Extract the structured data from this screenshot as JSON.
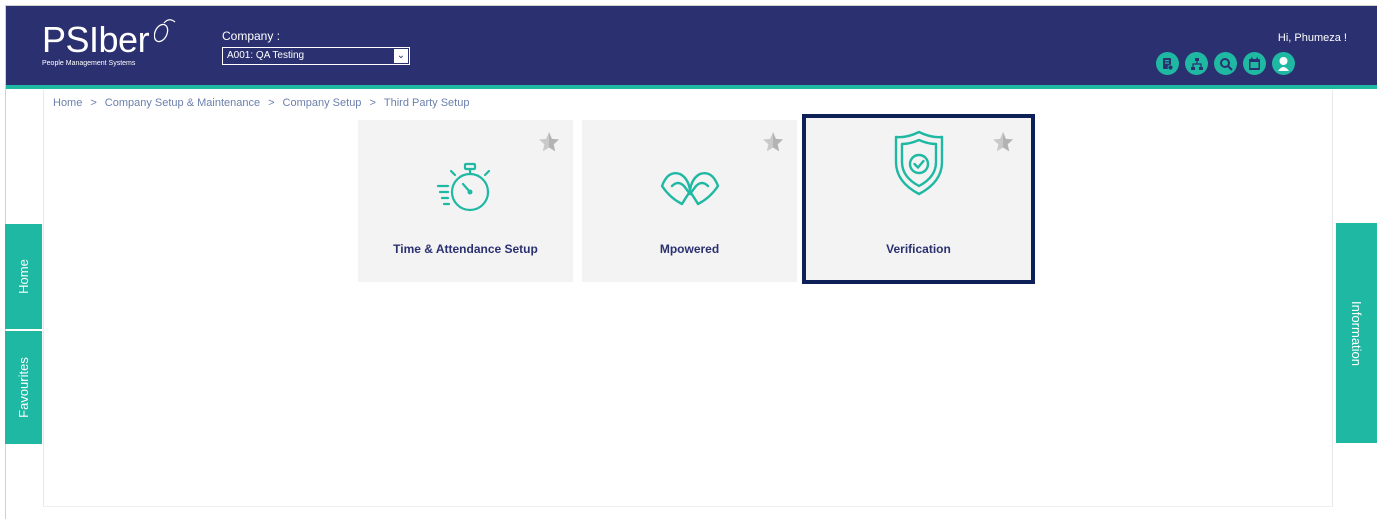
{
  "header": {
    "logo_text": "PSIber",
    "logo_subtext": "People Management Systems",
    "company_label": "Company :",
    "company_value": "A001: QA Testing",
    "greeting": "Hi, Phumeza !",
    "icons": [
      "documents-icon",
      "org-chart-icon",
      "search-icon",
      "calendar-icon",
      "profile-icon"
    ]
  },
  "breadcrumb": [
    "Home",
    "Company Setup & Maintenance",
    "Company Setup",
    "Third Party Setup"
  ],
  "breadcrumb_separator": ">",
  "tiles": [
    {
      "label": "Time & Attendance Setup",
      "icon": "stopwatch-icon",
      "selected": false
    },
    {
      "label": "Mpowered",
      "icon": "mpowered-icon",
      "selected": false
    },
    {
      "label": "Verification",
      "icon": "shield-check-icon",
      "selected": true
    }
  ],
  "side_tabs": {
    "home": "Home",
    "favourites": "Favourites",
    "information": "Information"
  },
  "colors": {
    "header_bg": "#2b3170",
    "accent": "#1fb8a3",
    "tile_bg": "#f3f3f3",
    "selected_border": "#0d2157"
  }
}
